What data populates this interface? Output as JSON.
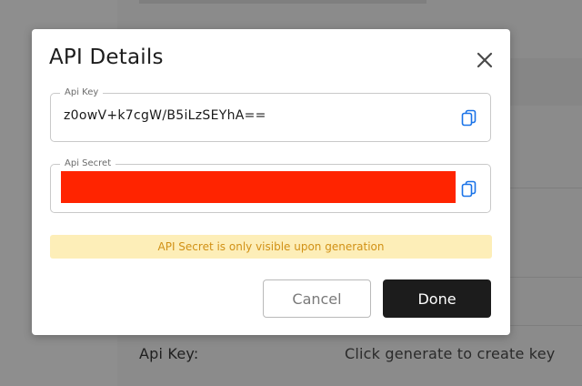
{
  "background": {
    "api_key_label": "Api Key:",
    "api_key_value": "Click generate to create key"
  },
  "modal": {
    "title": "API Details",
    "close_icon": "close-icon",
    "api_key": {
      "legend": "Api Key",
      "value": "z0owV+k7cgW/B5iLzSEYhA==",
      "copy_icon": "copy-icon"
    },
    "api_secret": {
      "legend": "Api Secret",
      "value_redacted": true,
      "redaction_color": "#ff2400",
      "copy_icon": "copy-icon"
    },
    "notice": "API Secret is only visible upon generation",
    "cancel_label": "Cancel",
    "done_label": "Done"
  },
  "colors": {
    "accent_icon": "#1a73e8",
    "notice_bg": "#fdeeb8",
    "notice_text": "#d19116",
    "done_bg": "#1c1c1c"
  }
}
